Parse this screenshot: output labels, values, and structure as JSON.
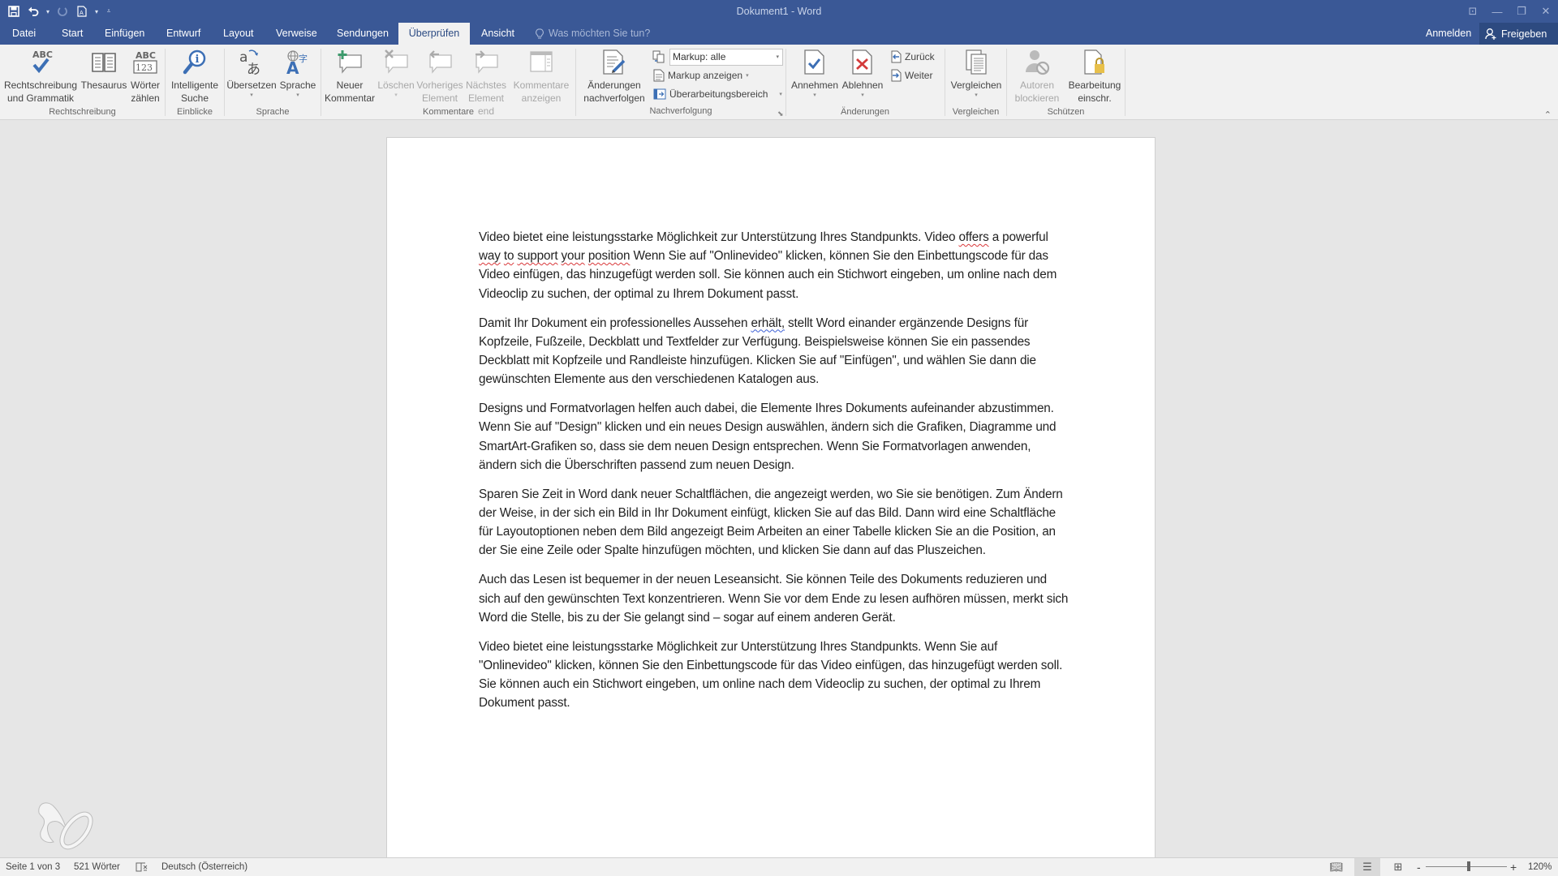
{
  "app": {
    "window_title": "Dokument1 - Word"
  },
  "quick_access": {
    "icons": [
      "save-icon",
      "undo-icon",
      "redo-icon",
      "new-document-icon",
      "customize-icon"
    ]
  },
  "window_controls": [
    "ribbon-display-options-icon",
    "minimize-icon",
    "restore-icon",
    "close-icon"
  ],
  "tabs": [
    {
      "label": "Datei"
    },
    {
      "label": "Start"
    },
    {
      "label": "Einfügen"
    },
    {
      "label": "Entwurf"
    },
    {
      "label": "Layout"
    },
    {
      "label": "Verweise"
    },
    {
      "label": "Sendungen"
    },
    {
      "label": "Überprüfen",
      "active": true
    },
    {
      "label": "Ansicht"
    }
  ],
  "tell_me": {
    "placeholder": "Was möchten Sie tun?"
  },
  "account": {
    "signin_label": "Anmelden",
    "share_label": "Freigeben"
  },
  "ribbon": {
    "groups": {
      "rechtschreibung": {
        "label": "Rechtschreibung",
        "spelling": {
          "line1": "Rechtschreibung",
          "line2": "und Grammatik"
        },
        "thesaurus": {
          "line1": "Thesaurus"
        },
        "wordcount": {
          "line1": "Wörter",
          "line2": "zählen"
        }
      },
      "einblicke": {
        "label": "Einblicke",
        "smart_lookup": {
          "line1": "Intelligente",
          "line2": "Suche"
        }
      },
      "sprache": {
        "label": "Sprache",
        "translate": {
          "line1": "Übersetzen"
        },
        "language": {
          "line1": "Sprache"
        }
      },
      "kommentare": {
        "label": "Kommentare",
        "new_comment": {
          "line1": "Neuer",
          "line2": "Kommentar"
        },
        "delete": {
          "line1": "Löschen"
        },
        "previous": {
          "line1": "Vorheriges",
          "line2": "Element"
        },
        "next": {
          "line1": "Nächstes",
          "line2": "Element"
        },
        "show_comments": {
          "line1": "Kommentare",
          "line2": "anzeigen"
        }
      },
      "nachverfolgung": {
        "label": "Nachverfolgung",
        "track_changes": {
          "line1": "Änderungen",
          "line2": "nachverfolgen"
        },
        "markup_select_value": "Markup: alle",
        "show_markup": "Markup anzeigen",
        "reviewing_pane": "Überarbeitungsbereich"
      },
      "aenderungen": {
        "label": "Änderungen",
        "accept": {
          "line1": "Annehmen"
        },
        "reject": {
          "line1": "Ablehnen"
        },
        "previous": "Zurück",
        "next": "Weiter"
      },
      "vergleichen": {
        "label": "Vergleichen",
        "compare": {
          "line1": "Vergleichen"
        }
      },
      "schuetzen": {
        "label": "Schützen",
        "block_authors": {
          "line1": "Autoren",
          "line2": "blockieren"
        },
        "restrict_editing": {
          "line1": "Bearbeitung",
          "line2": "einschr."
        }
      }
    }
  },
  "document": {
    "paragraphs": [
      [
        {
          "t": "Video bietet eine leistungsstarke Möglichkeit zur Unterstützung Ihres Standpunkts. Video "
        },
        {
          "t": "offers",
          "mark": "spell"
        },
        {
          "t": " a powerful "
        },
        {
          "t": "way",
          "mark": "spell"
        },
        {
          "t": " "
        },
        {
          "t": "to",
          "mark": "spell"
        },
        {
          "t": " "
        },
        {
          "t": "support",
          "mark": "spell"
        },
        {
          "t": " "
        },
        {
          "t": "your",
          "mark": "spell"
        },
        {
          "t": " "
        },
        {
          "t": "position",
          "mark": "spell"
        },
        {
          "t": " Wenn Sie auf \"Onlinevideo\" klicken, können Sie den Einbettungscode für das Video einfügen, das hinzugefügt werden soll. Sie können auch ein Stichwort eingeben, um online nach dem Videoclip zu suchen, der optimal zu Ihrem Dokument passt."
        }
      ],
      [
        {
          "t": "Damit Ihr Dokument ein professionelles Aussehen "
        },
        {
          "t": "erhält,",
          "mark": "gram"
        },
        {
          "t": " stellt Word einander ergänzende Designs für Kopfzeile, Fußzeile, Deckblatt und Textfelder zur Verfügung. Beispielsweise können Sie ein passendes Deckblatt mit Kopfzeile und Randleiste hinzufügen. Klicken Sie auf \"Einfügen\", und wählen Sie dann die gewünschten Elemente aus den verschiedenen Katalogen aus."
        }
      ],
      [
        {
          "t": "Designs und Formatvorlagen helfen auch dabei, die Elemente Ihres Dokuments aufeinander abzustimmen. Wenn Sie auf \"Design\" klicken und ein neues Design auswählen, ändern sich die Grafiken, Diagramme und SmartArt-Grafiken so, dass sie dem neuen Design entsprechen. Wenn Sie Formatvorlagen anwenden, ändern sich die Überschriften passend zum neuen Design."
        }
      ],
      [
        {
          "t": "Sparen Sie Zeit in Word dank neuer Schaltflächen, die angezeigt werden, wo Sie sie benötigen. Zum Ändern der Weise, in der sich ein Bild in Ihr Dokument einfügt, klicken Sie auf das Bild. Dann wird eine Schaltfläche für Layoutoptionen neben dem Bild angezeigt Beim Arbeiten an einer Tabelle klicken Sie an die Position, an der Sie eine Zeile oder Spalte hinzufügen möchten, und klicken Sie dann auf das Pluszeichen."
        }
      ],
      [
        {
          "t": "Auch das Lesen ist bequemer in der neuen Leseansicht. Sie können Teile des Dokuments reduzieren und sich auf den gewünschten Text konzentrieren. Wenn Sie vor dem Ende zu lesen aufhören müssen, merkt sich Word die Stelle, bis zu der Sie gelangt sind – sogar auf einem anderen Gerät."
        }
      ],
      [
        {
          "t": "Video bietet eine leistungsstarke Möglichkeit zur Unterstützung Ihres Standpunkts. Wenn Sie auf \"Onlinevideo\" klicken, können Sie den Einbettungscode für das Video einfügen, das hinzugefügt werden soll. Sie können auch ein Stichwort eingeben, um online nach dem Videoclip zu suchen, der optimal zu Ihrem Dokument passt."
        }
      ]
    ]
  },
  "statusbar": {
    "page": "Seite 1 von 3",
    "words": "521 Wörter",
    "proofing_icon": "proofing-errors-icon",
    "language": "Deutsch (Österreich)",
    "zoom_minus": "-",
    "zoom_plus": "+",
    "zoom_label": "120%",
    "zoom_percent": 120
  },
  "colors": {
    "title_bar": "#3a5896",
    "ribbon_bg": "#f1f1f1",
    "canvas_bg": "#e6e6e6",
    "spelling_error": "#d9383a",
    "grammar_error": "#3b5ed6"
  }
}
